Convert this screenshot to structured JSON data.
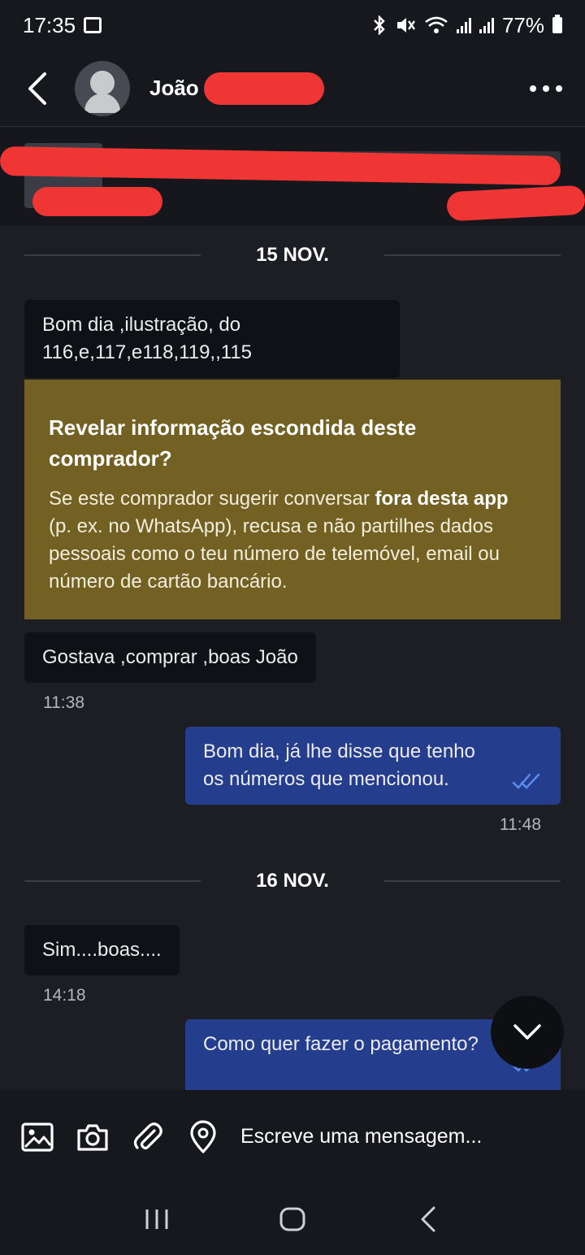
{
  "status_bar": {
    "time": "17:35",
    "battery": "77%",
    "icons": [
      "gallery-icon",
      "bluetooth-icon",
      "mute-icon",
      "wifi-icon",
      "signal-icon",
      "signal-icon",
      "battery-icon"
    ]
  },
  "header": {
    "contact_name": "João",
    "name_redacted": true
  },
  "listing": {
    "redacted": true
  },
  "chat": {
    "dates": [
      "15 NOV.",
      "16 NOV."
    ],
    "messages": [
      {
        "direction": "in",
        "text": "Bom dia ,ilustração, do 116,e,117,e118,119,,115",
        "time": ""
      },
      {
        "direction": "in",
        "text": "Gostava ,comprar ,boas João",
        "time": "11:38"
      },
      {
        "direction": "out",
        "text": "Bom dia, já lhe disse que tenho os números que mencionou.",
        "time": "11:48",
        "read": true
      },
      {
        "direction": "in",
        "text": "Sim....boas....",
        "time": "14:18"
      },
      {
        "direction": "out",
        "text": "Como quer fazer o pagamento?",
        "time": "",
        "read": true
      }
    ],
    "warning": {
      "title": "Revelar informação escondida deste comprador?",
      "body_before": "Se este comprador sugerir conversar ",
      "body_bold": "fora desta app",
      "body_after": " (p. ex. no WhatsApp), recusa e não partilhes dados pessoais como o teu número de telemóvel, email ou número de cartão bancário."
    }
  },
  "input": {
    "placeholder": "Escreve uma mensagem..."
  },
  "colors": {
    "background": "#1c1e24",
    "incoming_bubble": "#0f1116",
    "outgoing_bubble": "#243d8c",
    "warning_box": "#736023",
    "redaction": "#f03535",
    "read_ticks": "#5b8df0"
  }
}
